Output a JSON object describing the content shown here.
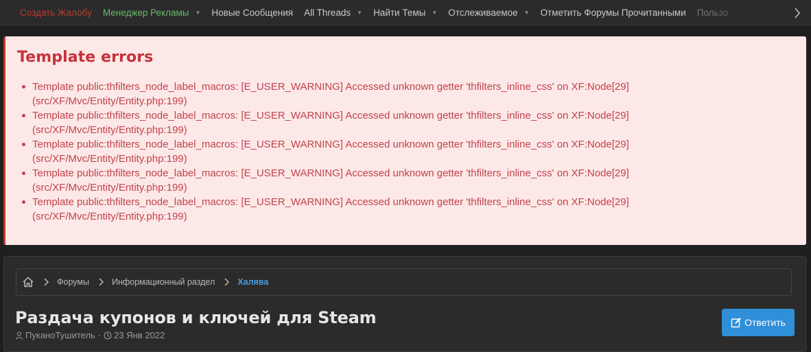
{
  "nav": {
    "items": [
      {
        "label": "Создать Жалобу",
        "has_menu": false
      },
      {
        "label": "Менеджер Рекламы",
        "has_menu": true
      },
      {
        "label": "Новые Сообщения",
        "has_menu": false
      },
      {
        "label": "All Threads",
        "has_menu": true
      },
      {
        "label": "Найти Темы",
        "has_menu": true
      },
      {
        "label": "Отслеживаемое",
        "has_menu": true
      },
      {
        "label": "Отметить Форумы Прочитанными",
        "has_menu": false
      },
      {
        "label": "Пользо",
        "has_menu": false
      }
    ]
  },
  "errors": {
    "title": "Template errors",
    "items": [
      {
        "line1": "Template public:thfilters_node_label_macros: [E_USER_WARNING] Accessed unknown getter 'thfilters_inline_css' on XF:Node[29]",
        "line2": "(src/XF/Mvc/Entity/Entity.php:199)"
      },
      {
        "line1": "Template public:thfilters_node_label_macros: [E_USER_WARNING] Accessed unknown getter 'thfilters_inline_css' on XF:Node[29]",
        "line2": "(src/XF/Mvc/Entity/Entity.php:199)"
      },
      {
        "line1": "Template public:thfilters_node_label_macros: [E_USER_WARNING] Accessed unknown getter 'thfilters_inline_css' on XF:Node[29]",
        "line2": "(src/XF/Mvc/Entity/Entity.php:199)"
      },
      {
        "line1": "Template public:thfilters_node_label_macros: [E_USER_WARNING] Accessed unknown getter 'thfilters_inline_css' on XF:Node[29]",
        "line2": "(src/XF/Mvc/Entity/Entity.php:199)"
      },
      {
        "line1": "Template public:thfilters_node_label_macros: [E_USER_WARNING] Accessed unknown getter 'thfilters_inline_css' on XF:Node[29]",
        "line2": "(src/XF/Mvc/Entity/Entity.php:199)"
      }
    ]
  },
  "breadcrumb": {
    "items": [
      "Форумы",
      "Информационный раздел"
    ],
    "current": "Халява"
  },
  "thread": {
    "title": "Раздача купонов и ключей для Steam",
    "author": "ПуканоТушитель",
    "date": "23 Янв 2022",
    "meta_separator": "·"
  },
  "reply_button": {
    "label": "Ответить"
  },
  "colors": {
    "accent": "#2f8fd8",
    "error": "#c4333c",
    "error_bg": "#fde8e8",
    "nav_red": "#c0392b",
    "nav_green": "#6bb86b"
  }
}
